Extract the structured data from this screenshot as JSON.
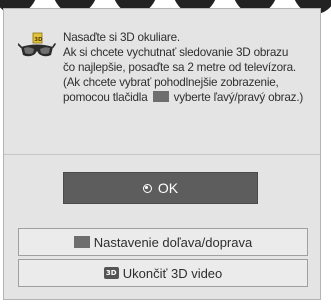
{
  "dialog": {
    "message_lines": [
      "Nasaďte si 3D okuliare.",
      "Ak si chcete vychutnať sledovanie 3D obrazu",
      "čo najlepšie, posaďte sa 2 metre od televízora.",
      "(Ak chcete vybrať pohodlnejšie zobrazenie,"
    ],
    "message_last_before": "pomocou tlačidla",
    "message_last_after": "vyberte ľavý/pravý obraz.)",
    "icon_glasses": "3d-glasses-icon",
    "ok_label": "OK",
    "ok_icon": "ok-circle-icon",
    "lr_label": "Nastavenie doľava/doprava",
    "lr_icon": "grey-square-icon",
    "exit_label": "Ukončiť 3D video",
    "exit_icon_text": "3D",
    "exit_icon": "3d-badge-icon"
  },
  "colors": {
    "dialog_bg": "#e4e4e4",
    "ok_bg": "#5d5d5d",
    "button_bg": "#ebebeb",
    "text": "#2f2f2f"
  }
}
